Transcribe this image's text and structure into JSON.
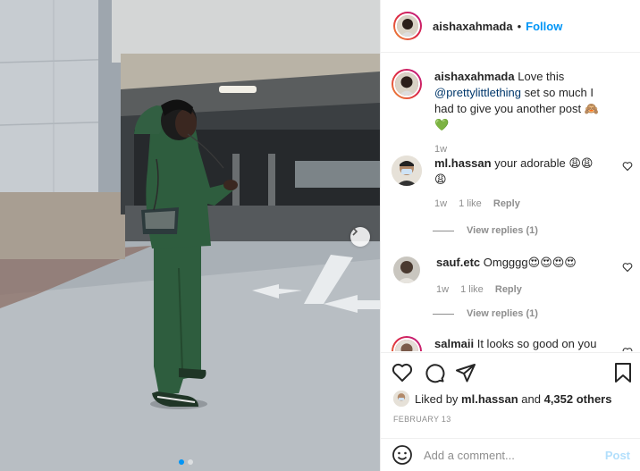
{
  "post": {
    "author": "aishaxahmada",
    "separator": "•",
    "follow_label": "Follow"
  },
  "caption": {
    "username": "aishaxahmada",
    "text_before": "Love this",
    "mention": "@prettylittlething",
    "text_after": "set so much I had to give you another post",
    "emojis": "🙈💚",
    "time": "1w"
  },
  "comments": [
    {
      "username": "ml.hassan",
      "text": "your adorable",
      "emojis": "😩😩😩",
      "time": "1w",
      "likes": "1 like",
      "reply_label": "Reply",
      "view_replies": "View replies (1)"
    },
    {
      "username": "sauf.etc",
      "text": "Omgggg",
      "emojis": "😍😍😍😍",
      "time": "1w",
      "likes": "1 like",
      "reply_label": "Reply",
      "view_replies": "View replies (1)"
    },
    {
      "username": "salmaii",
      "text": "It looks so good on you"
    }
  ],
  "likes": {
    "prefix": "Liked by",
    "user": "ml.hassan",
    "middle": "and",
    "count": "4,352 others"
  },
  "date": "FEBRUARY 13",
  "add_comment": {
    "placeholder": "Add a comment...",
    "post_label": "Post"
  },
  "icons": {
    "like": "heart-icon",
    "comment": "comment-icon",
    "share": "share-icon",
    "save": "bookmark-icon",
    "emoji": "smiley-icon",
    "next": "chevron-right-icon"
  },
  "colors": {
    "accent": "#0095f6",
    "tracksuit": "#2e5d3e",
    "post_disabled": "#b2dffc"
  },
  "carousel": {
    "count": 2,
    "active": 1
  }
}
